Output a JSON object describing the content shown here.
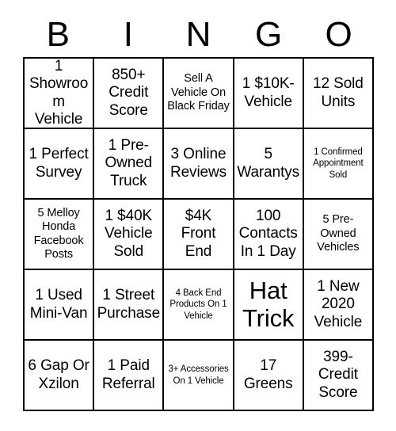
{
  "card": {
    "header_letters": [
      "B",
      "I",
      "N",
      "G",
      "O"
    ],
    "rows": [
      [
        {
          "text": "1 Showroom Vehicle",
          "size": "normal"
        },
        {
          "text": "850+ Credit Score",
          "size": "normal"
        },
        {
          "text": "Sell A Vehicle On Black Friday",
          "size": "medium"
        },
        {
          "text": "1 $10K-Vehicle",
          "size": "normal"
        },
        {
          "text": "12 Sold Units",
          "size": "normal"
        }
      ],
      [
        {
          "text": "1 Perfect Survey",
          "size": "normal"
        },
        {
          "text": "1 Pre-Owned Truck",
          "size": "normal"
        },
        {
          "text": "3 Online Reviews",
          "size": "normal"
        },
        {
          "text": "5 Warantys",
          "size": "normal"
        },
        {
          "text": "1 Confirmed Appointment Sold",
          "size": "small"
        }
      ],
      [
        {
          "text": "5 Melloy Honda Facebook Posts",
          "size": "medium"
        },
        {
          "text": "1 $40K Vehicle Sold",
          "size": "normal"
        },
        {
          "text": "$4K Front End",
          "size": "normal"
        },
        {
          "text": "100 Contacts In 1 Day",
          "size": "normal"
        },
        {
          "text": "5 Pre-Owned Vehicles",
          "size": "medium"
        }
      ],
      [
        {
          "text": "1 Used Mini-Van",
          "size": "normal"
        },
        {
          "text": "1 Street Purchase",
          "size": "normal"
        },
        {
          "text": "4 Back End Products On 1 Vehicle",
          "size": "small"
        },
        {
          "text": "Hat Trick",
          "size": "large"
        },
        {
          "text": "1 New 2020 Vehicle",
          "size": "normal"
        }
      ],
      [
        {
          "text": "6 Gap Or Xzilon",
          "size": "normal"
        },
        {
          "text": "1 Paid Referral",
          "size": "normal"
        },
        {
          "text": "3+ Accessories On 1 Vehicle",
          "size": "small"
        },
        {
          "text": "17 Greens",
          "size": "normal"
        },
        {
          "text": "399-Credit Score",
          "size": "normal"
        }
      ]
    ]
  }
}
